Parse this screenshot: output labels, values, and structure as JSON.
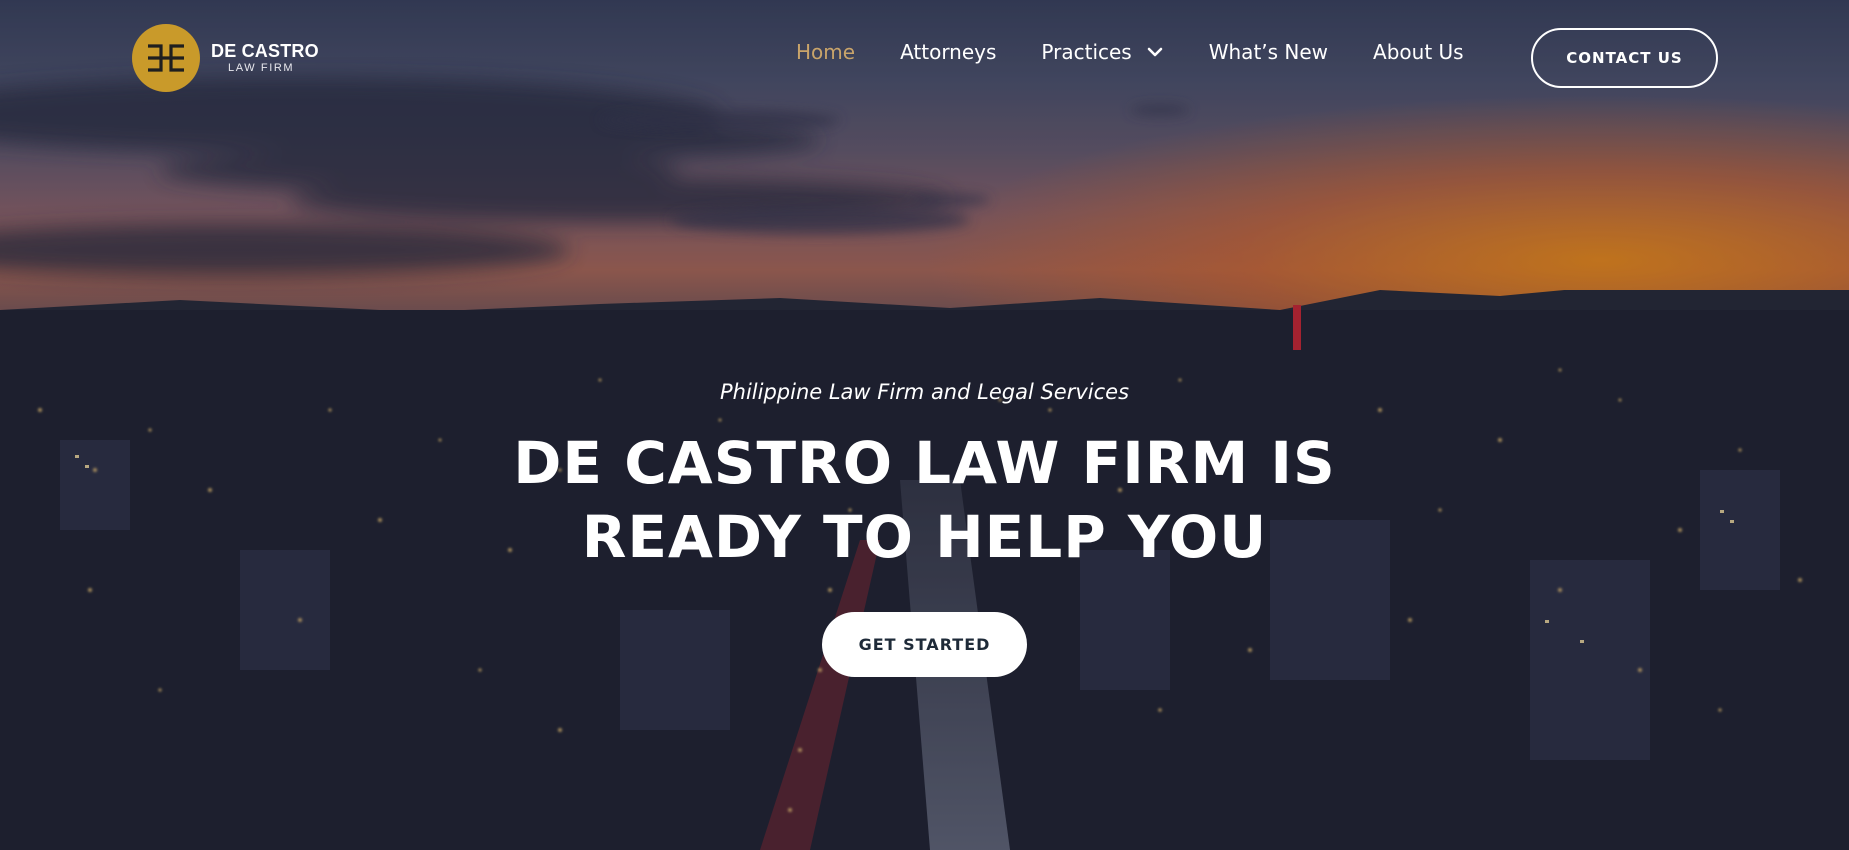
{
  "brand": {
    "name": "DE CASTRO",
    "subtitle": "LAW FIRM",
    "logo_color": "#c99a2a"
  },
  "nav": {
    "items": [
      {
        "label": "Home",
        "active": true
      },
      {
        "label": "Attorneys",
        "active": false
      },
      {
        "label": "Practices",
        "active": false,
        "has_dropdown": true
      },
      {
        "label": "What’s New",
        "active": false
      },
      {
        "label": "About Us",
        "active": false
      }
    ],
    "active_color": "#c9a46a"
  },
  "header": {
    "contact_label": "CONTACT US"
  },
  "hero": {
    "tagline": "Philippine Law Firm and Legal Services",
    "headline_line1": "DE CASTRO LAW FIRM IS",
    "headline_line2": "READY TO HELP YOU",
    "cta_label": "GET STARTED",
    "background": "city-night-sunset-photo"
  }
}
